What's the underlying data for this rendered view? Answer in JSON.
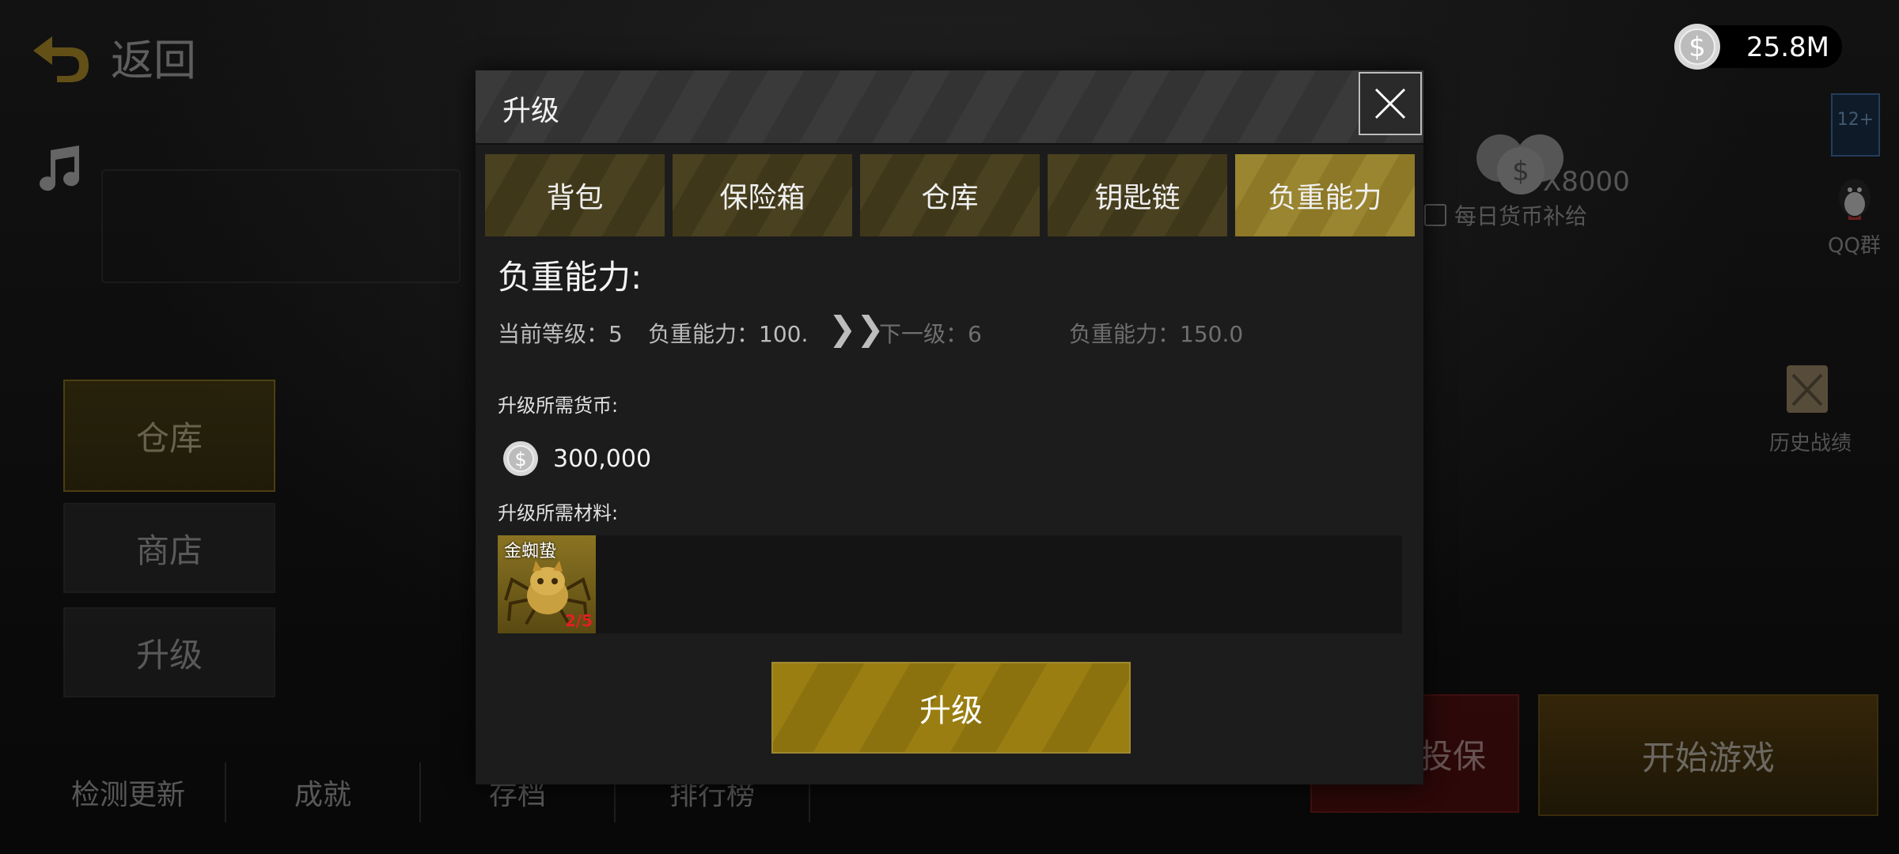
{
  "background": {
    "back_label": "返回",
    "side_menu": [
      {
        "label": "仓库",
        "active": true
      },
      {
        "label": "商店",
        "active": false
      },
      {
        "label": "升级",
        "active": false
      }
    ],
    "bottom_menu": [
      "检测更新",
      "成就",
      "存档",
      "排行榜"
    ],
    "daily_reward": {
      "amount": "X8000",
      "label": "每日货币补给"
    },
    "age_badge": "12+",
    "qq_label": "QQ群",
    "history_label": "历史战绩",
    "red_button_label": "投保",
    "start_button_label": "开始游戏"
  },
  "currency": {
    "amount": "25.8M",
    "icon": "silver-dollar-coin-icon"
  },
  "modal": {
    "title": "升级",
    "close_icon": "close-icon",
    "tabs": [
      {
        "label": "背包",
        "active": false
      },
      {
        "label": "保险箱",
        "active": false
      },
      {
        "label": "仓库",
        "active": false
      },
      {
        "label": "钥匙链",
        "active": false
      },
      {
        "label": "负重能力",
        "active": true
      }
    ],
    "section_title": "负重能力:",
    "current_level": "当前等级：5",
    "current_capacity": "负重能力：100.",
    "next_level": "下一级：6",
    "next_capacity": "负重能力：150.0",
    "required_currency_label": "升级所需货币:",
    "cost": "300,000",
    "required_material_label": "升级所需材料:",
    "material": {
      "name": "金蜘蛰",
      "count": "2/5"
    },
    "upgrade_button": "升级"
  },
  "colors": {
    "tab_active": "#9a8530",
    "tab_inactive": "#4a4120",
    "button_gold": "#9a7e12",
    "material_count": "#e02020"
  }
}
